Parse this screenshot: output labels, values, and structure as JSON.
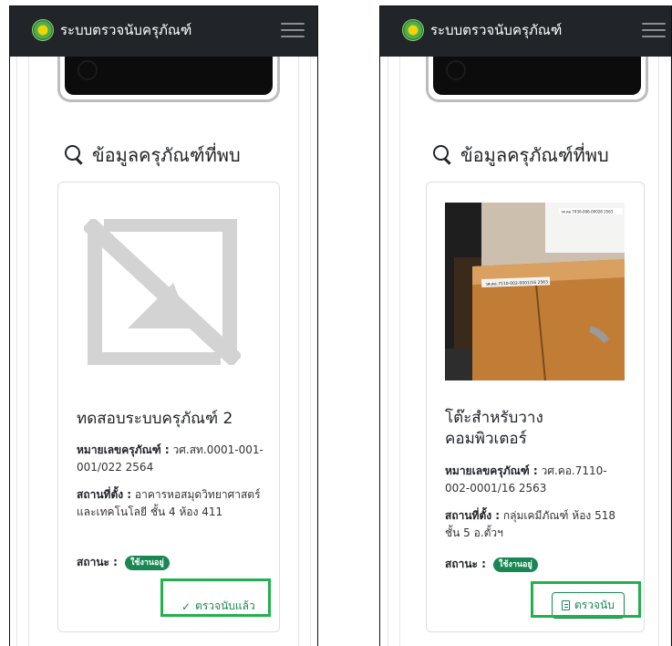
{
  "app": {
    "brand": "ระบบตรวจนับครุภัณฑ์"
  },
  "section_title": "ข้อมูลครุภัณฑ์ที่พบ",
  "left": {
    "title": "ทดสอบระบบครุภัณฑ์ 2",
    "asset_no_label": "หมายเลขครุภัณฑ์ :",
    "asset_no_value": " วศ.สท.0001-001-001/022 2564",
    "location_label": "สถานที่ตั้ง :",
    "location_value": " อาคารหอสมุดวิทยาศาสตร์และเทคโนโลยี ชั้น 4 ห้อง 411",
    "status_label": "สถานะ :",
    "status_badge": "ใช้งานอยู่",
    "action_label": "ตรวจนับแล้ว",
    "image": "no-image-icon"
  },
  "right": {
    "title": "โต๊ะสำหรับวางคอมพิวเตอร์",
    "asset_no_label": "หมายเลขครุภัณฑ์ :",
    "asset_no_value": " วศ.คอ.7110-002-0001/16 2563",
    "location_label": "สถานที่ตั้ง :",
    "location_value": " กลุ่มเคมีภัณฑ์ ห้อง 518 ชั้น 5 อ.ตั้วฯ",
    "status_label": "สถานะ :",
    "status_badge": "ใช้งานอยู่",
    "action_label": "ตรวจนับ",
    "image": "asset-photo",
    "photo_sticker_top": "วศ.คอ.7430-006-00028 2563",
    "photo_sticker_side": "วศ.คอ.7110-002-0001/16 2563"
  },
  "colors": {
    "navbar": "#212529",
    "success": "#198754",
    "highlight": "#22b14c"
  }
}
